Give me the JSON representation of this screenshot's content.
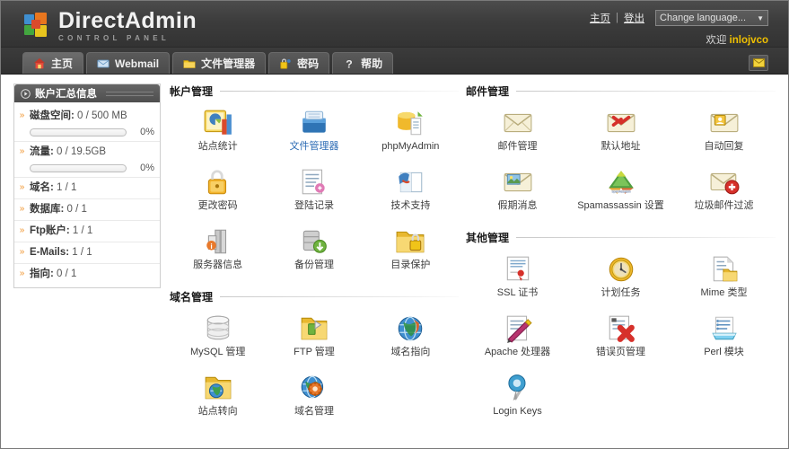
{
  "header": {
    "brand_title": "DirectAdmin",
    "brand_subtitle": "CONTROL PANEL",
    "home_link": "主页",
    "separator": "|",
    "logout_link": "登出",
    "language_select": "Change language...",
    "language_caret": "▼",
    "welcome_prefix": "欢迎",
    "username": "inlojvco",
    "accent_user_color": "#f0c000"
  },
  "tabs": [
    {
      "label": "主页",
      "icon": "home-icon",
      "active": true
    },
    {
      "label": "Webmail",
      "icon": "envelope-icon",
      "active": false
    },
    {
      "label": "文件管理器",
      "icon": "folder-icon",
      "active": false
    },
    {
      "label": "密码",
      "icon": "lock-key-icon",
      "active": false
    },
    {
      "label": "帮助",
      "icon": "question-mark-icon",
      "active": false
    }
  ],
  "mail_button": {
    "name": "mail-button",
    "icon": "envelope-icon"
  },
  "sidebar": {
    "panel_title": "账户汇总信息",
    "stats": [
      {
        "label": "磁盘空间:",
        "value": "0 / 500 MB",
        "has_bar": true,
        "percent": "0%",
        "fill": 0
      },
      {
        "label": "流量:",
        "value": "0 / 19.5GB",
        "has_bar": true,
        "percent": "0%",
        "fill": 0
      },
      {
        "label": "域名:",
        "value": "1 / 1",
        "has_bar": false
      },
      {
        "label": "数据库:",
        "value": "0 / 1",
        "has_bar": false
      },
      {
        "label": "Ftp账户:",
        "value": "1 / 1",
        "has_bar": false
      },
      {
        "label": "E-Mails:",
        "value": "1 / 1",
        "has_bar": false
      },
      {
        "label": "指向:",
        "value": "0 / 1",
        "has_bar": false
      }
    ]
  },
  "sections": {
    "account": {
      "title": "帐户管理",
      "items": [
        {
          "label": "站点统计",
          "icon": "chart-pie-bar-icon",
          "highlight": false
        },
        {
          "label": "文件管理器",
          "icon": "file-box-icon",
          "highlight": true
        },
        {
          "label": "phpMyAdmin",
          "icon": "database-page-icon",
          "highlight": false
        },
        {
          "label": "更改密码",
          "icon": "padlock-icon",
          "highlight": false
        },
        {
          "label": "登陆记录",
          "icon": "document-list-icon",
          "highlight": false
        },
        {
          "label": "技术支持",
          "icon": "support-book-icon",
          "highlight": false
        },
        {
          "label": "服务器信息",
          "icon": "server-info-icon",
          "highlight": false
        },
        {
          "label": "备份管理",
          "icon": "server-download-icon",
          "highlight": false
        },
        {
          "label": "目录保护",
          "icon": "folder-lock-icon",
          "highlight": false
        }
      ]
    },
    "domain": {
      "title": "域名管理",
      "items": [
        {
          "label": "MySQL 管理",
          "icon": "database-icon",
          "highlight": false
        },
        {
          "label": "FTP 管理",
          "icon": "folder-ftp-icon",
          "highlight": false
        },
        {
          "label": "域名指向",
          "icon": "globe-icon",
          "highlight": false
        },
        {
          "label": "站点转向",
          "icon": "folder-globe-icon",
          "highlight": false
        },
        {
          "label": "域名管理",
          "icon": "globe-gear-icon",
          "highlight": false
        }
      ]
    },
    "mail": {
      "title": "邮件管理",
      "items": [
        {
          "label": "邮件管理",
          "icon": "envelope-icon",
          "highlight": false
        },
        {
          "label": "默认地址",
          "icon": "envelope-arrow-icon",
          "highlight": false
        },
        {
          "label": "自动回复",
          "icon": "envelope-reply-icon",
          "highlight": false
        },
        {
          "label": "假期消息",
          "icon": "envelope-photo-icon",
          "highlight": false
        },
        {
          "label": "Spamassassin 设置",
          "icon": "spamassassin-icon",
          "highlight": false
        },
        {
          "label": "垃圾邮件过滤",
          "icon": "envelope-block-icon",
          "highlight": false
        }
      ]
    },
    "other": {
      "title": "其他管理",
      "items": [
        {
          "label": "SSL 证书",
          "icon": "certificate-icon",
          "highlight": false
        },
        {
          "label": "计划任务",
          "icon": "clock-icon",
          "highlight": false
        },
        {
          "label": "Mime 类型",
          "icon": "document-folder-icon",
          "highlight": false
        },
        {
          "label": "Apache 处理器",
          "icon": "document-pen-icon",
          "highlight": false
        },
        {
          "label": "错误页管理",
          "icon": "document-error-icon",
          "highlight": false
        },
        {
          "label": "Perl 模块",
          "icon": "perl-list-icon",
          "highlight": false
        },
        {
          "label": "Login Keys",
          "icon": "key-pin-icon",
          "highlight": false
        }
      ]
    }
  }
}
